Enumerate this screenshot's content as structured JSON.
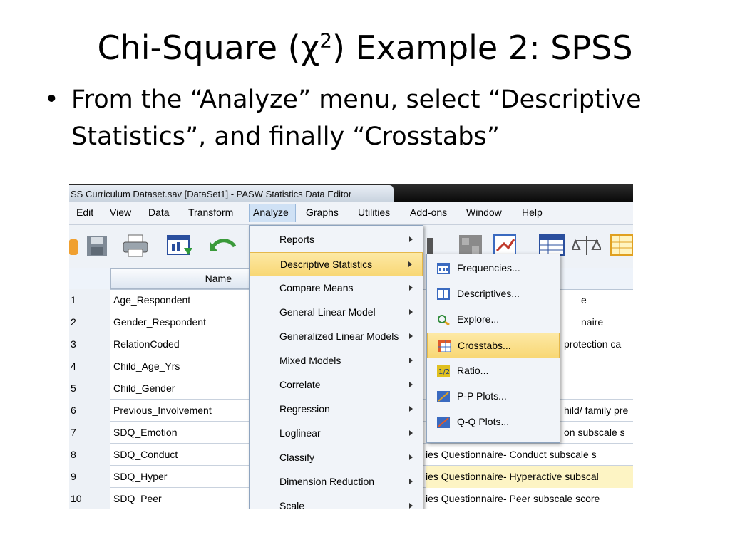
{
  "slide": {
    "title_pre": "Chi-Square (χ",
    "title_sup": "2",
    "title_post": ") Example 2: SPSS",
    "bullet_marker": "•",
    "bullet_text": "From the “Analyze” menu, select “Descriptive Statistics”, and finally “Crosstabs”"
  },
  "window": {
    "title": "SS Curriculum Dataset.sav [DataSet1] - PASW Statistics Data Editor"
  },
  "menubar": {
    "items": [
      "Edit",
      "View",
      "Data",
      "Transform",
      "Analyze",
      "Graphs",
      "Utilities",
      "Add-ons",
      "Window",
      "Help"
    ],
    "active": "Analyze"
  },
  "grid": {
    "name_header": "Name",
    "rows": [
      {
        "num": "1",
        "name": "Age_Respondent",
        "label": "e"
      },
      {
        "num": "2",
        "name": "Gender_Respondent",
        "label": "naire"
      },
      {
        "num": "3",
        "name": "RelationCoded",
        "label": "protection ca"
      },
      {
        "num": "4",
        "name": "Child_Age_Yrs",
        "label": ""
      },
      {
        "num": "5",
        "name": "Child_Gender",
        "label": ""
      },
      {
        "num": "6",
        "name": "Previous_Involvement",
        "label": "hild/ family pre"
      },
      {
        "num": "7",
        "name": "SDQ_Emotion",
        "label": "on subscale s"
      },
      {
        "num": "8",
        "name": "SDQ_Conduct",
        "label": "ies Questionnaire- Conduct subscale s"
      },
      {
        "num": "9",
        "name": "SDQ_Hyper",
        "label": "ies Questionnaire- Hyperactive subscal"
      },
      {
        "num": "10",
        "name": "SDQ_Peer",
        "label": "ies Questionnaire- Peer subscale score"
      }
    ],
    "highlight_row": "9"
  },
  "analyze_menu": {
    "items": [
      "Reports",
      "Descriptive Statistics",
      "Compare Means",
      "General Linear Model",
      "Generalized Linear Models",
      "Mixed Models",
      "Correlate",
      "Regression",
      "Loglinear",
      "Classify",
      "Dimension Reduction",
      "Scale"
    ],
    "highlighted": "Descriptive Statistics"
  },
  "descriptive_submenu": {
    "items": [
      {
        "label": "Frequencies...",
        "icon": "frequencies-icon"
      },
      {
        "label": "Descriptives...",
        "icon": "descriptives-icon"
      },
      {
        "label": "Explore...",
        "icon": "explore-icon"
      },
      {
        "label": "Crosstabs...",
        "icon": "crosstabs-icon"
      },
      {
        "label": "Ratio...",
        "icon": "ratio-icon"
      },
      {
        "label": "P-P Plots...",
        "icon": "pp-plots-icon"
      },
      {
        "label": "Q-Q Plots...",
        "icon": "qq-plots-icon"
      }
    ],
    "highlighted": "Crosstabs..."
  },
  "colors": {
    "menu_highlight": "#f8d775",
    "menubar_bg": "#f0f3f8",
    "row_highlight": "#fdf4c4"
  }
}
